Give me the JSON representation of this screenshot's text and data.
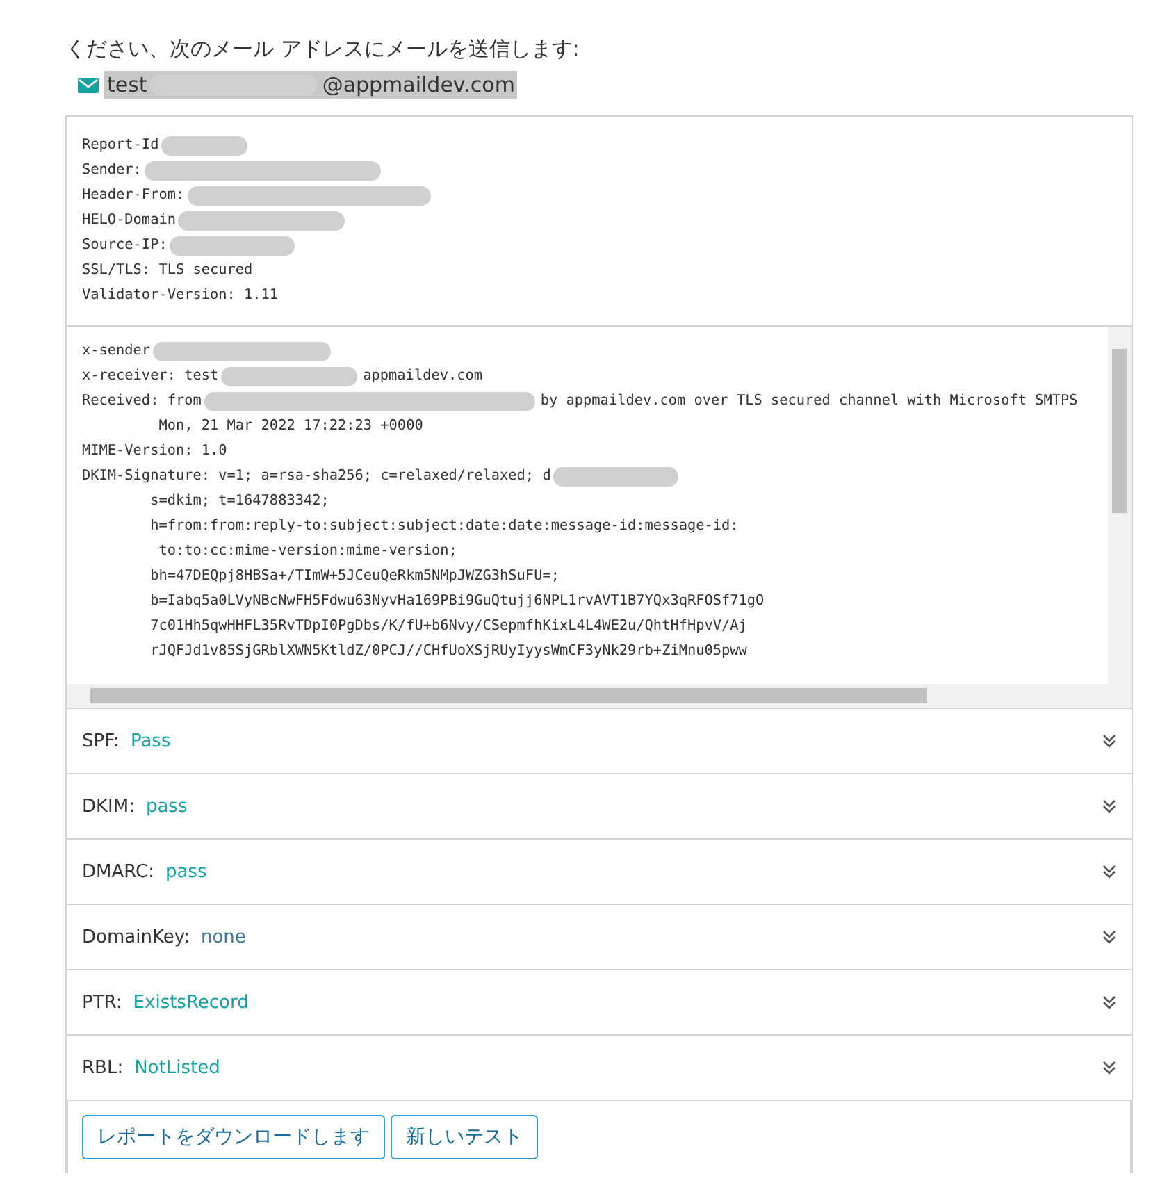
{
  "intro": "ください、次のメール アドレスにメールを送信します:",
  "address": {
    "selected": true,
    "parts": [
      {
        "kind": "text",
        "text": "test"
      },
      {
        "kind": "redaction"
      },
      {
        "kind": "text",
        "text": "@appmaildev.com"
      }
    ]
  },
  "report": [
    {
      "parts": [
        {
          "kind": "text",
          "text": "Report-Id"
        },
        {
          "kind": "redaction"
        }
      ]
    },
    {
      "parts": [
        {
          "kind": "text",
          "text": "Sender:"
        },
        {
          "kind": "redaction"
        }
      ]
    },
    {
      "parts": [
        {
          "kind": "text",
          "text": "Header-From:"
        },
        {
          "kind": "redaction"
        }
      ]
    },
    {
      "parts": [
        {
          "kind": "text",
          "text": "HELO-Domain"
        },
        {
          "kind": "redaction"
        }
      ]
    },
    {
      "parts": [
        {
          "kind": "text",
          "text": "Source-IP:"
        },
        {
          "kind": "redaction"
        }
      ]
    },
    {
      "parts": [
        {
          "kind": "text",
          "text": "SSL/TLS: TLS secured"
        }
      ]
    },
    {
      "parts": [
        {
          "kind": "text",
          "text": "Validator-Version: 1.11"
        }
      ]
    }
  ],
  "headers": [
    {
      "parts": [
        {
          "kind": "text",
          "text": "x-sender"
        },
        {
          "kind": "redaction"
        }
      ]
    },
    {
      "parts": [
        {
          "kind": "text",
          "text": "x-receiver: test"
        },
        {
          "kind": "redaction"
        },
        {
          "kind": "text",
          "text": "appmaildev.com"
        }
      ]
    },
    {
      "parts": [
        {
          "kind": "text",
          "text": "Received: from"
        },
        {
          "kind": "redaction"
        },
        {
          "kind": "text",
          "text": "by appmaildev.com over TLS secured channel with Microsoft SMTPS"
        }
      ]
    },
    {
      "parts": [
        {
          "kind": "text",
          "text": "         Mon, 21 Mar 2022 17:22:23 +0000"
        }
      ]
    },
    {
      "parts": [
        {
          "kind": "text",
          "text": "MIME-Version: 1.0"
        }
      ]
    },
    {
      "parts": [
        {
          "kind": "text",
          "text": "DKIM-Signature: v=1; a=rsa-sha256; c=relaxed/relaxed; d"
        },
        {
          "kind": "redaction"
        }
      ]
    },
    {
      "parts": [
        {
          "kind": "text",
          "text": "        s=dkim; t=1647883342;"
        }
      ]
    },
    {
      "parts": [
        {
          "kind": "text",
          "text": "        h=from:from:reply-to:subject:subject:date:date:message-id:message-id:"
        }
      ]
    },
    {
      "parts": [
        {
          "kind": "text",
          "text": "         to:to:cc:mime-version:mime-version;"
        }
      ]
    },
    {
      "parts": [
        {
          "kind": "text",
          "text": "        bh=47DEQpj8HBSa+/TImW+5JCeuQeRkm5NMpJWZG3hSuFU=;"
        }
      ]
    },
    {
      "parts": [
        {
          "kind": "text",
          "text": "        b=Iabq5a0LVyNBcNwFH5Fdwu63NyvHa169PBi9GuQtujj6NPL1rvAVT1B7YQx3qRFOSf71gO"
        }
      ]
    },
    {
      "parts": [
        {
          "kind": "text",
          "text": "        7c01Hh5qwHHFL35RvTDpI0PgDbs/K/fU+b6Nvy/CSepmfhKixL4L4WE2u/QhtHfHpvV/Aj"
        }
      ]
    },
    {
      "parts": [
        {
          "kind": "text",
          "text": "        rJQFJd1v85SjGRblXWN5KtldZ/0PCJ//CHfUoXSjRUyIyysWmCF3yNk29rb+ZiMnu05pww"
        }
      ]
    }
  ],
  "checks": [
    {
      "label": "SPF:",
      "value": "Pass",
      "color": "#17a2a2",
      "expanded": false
    },
    {
      "label": "DKIM:",
      "value": "pass",
      "color": "#17a2a2",
      "expanded": false
    },
    {
      "label": "DMARC:",
      "value": "pass",
      "color": "#17a2a2",
      "expanded": false
    },
    {
      "label": "DomainKey:",
      "value": "none",
      "color": "#3a7a96",
      "expanded": false
    },
    {
      "label": "PTR:",
      "value": "ExistsRecord",
      "color": "#17a2a2",
      "expanded": false
    },
    {
      "label": "RBL:",
      "value": "NotListed",
      "color": "#17a2a2",
      "expanded": false
    }
  ],
  "buttons": [
    "レポートをダウンロードします",
    "新しいテスト"
  ]
}
